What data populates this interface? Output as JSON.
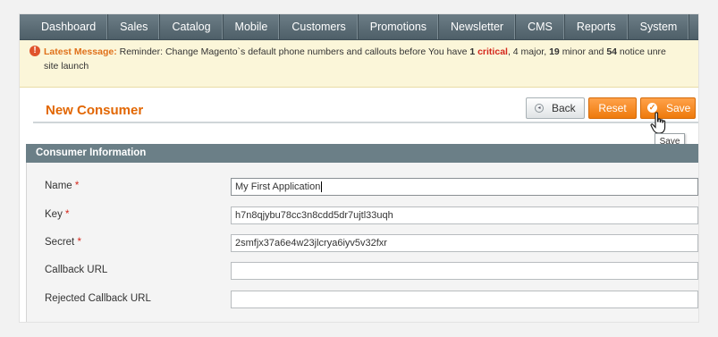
{
  "nav": {
    "items": [
      {
        "label": "Dashboard"
      },
      {
        "label": "Sales"
      },
      {
        "label": "Catalog"
      },
      {
        "label": "Mobile"
      },
      {
        "label": "Customers"
      },
      {
        "label": "Promotions"
      },
      {
        "label": "Newsletter"
      },
      {
        "label": "CMS"
      },
      {
        "label": "Reports"
      },
      {
        "label": "System"
      }
    ]
  },
  "message": {
    "prefix": "Latest Message:",
    "text": "Reminder: Change Magento`s default phone numbers and callouts before",
    "you_have": "You have",
    "critical_count": "1",
    "critical_label": "critical",
    "major": "4 major,",
    "minor_count": "19",
    "minor": "minor and",
    "notice_count": "54",
    "notice": "notice unre",
    "line2": "site launch"
  },
  "page": {
    "title": "New Consumer"
  },
  "buttons": {
    "back": "Back",
    "reset": "Reset",
    "save": "Save",
    "save_tooltip": "Save"
  },
  "section": {
    "title": "Consumer Information"
  },
  "form": {
    "name_label": "Name",
    "name_value": "My First Application",
    "key_label": "Key",
    "key_value": "h7n8qjybu78cc3n8cdd5dr7ujtl33uqh",
    "secret_label": "Secret",
    "secret_value": "2smfjx37a6e4w23jlcrya6iyv5v32fxr",
    "callback_label": "Callback URL",
    "callback_value": "",
    "rejected_label": "Rejected Callback URL",
    "rejected_value": "",
    "required_mark": "*"
  },
  "colors": {
    "accent": "#ee7a0c",
    "title": "#e26703",
    "nav": "#5a6b73",
    "section_header": "#6b7f87",
    "critical": "#d4271c"
  }
}
